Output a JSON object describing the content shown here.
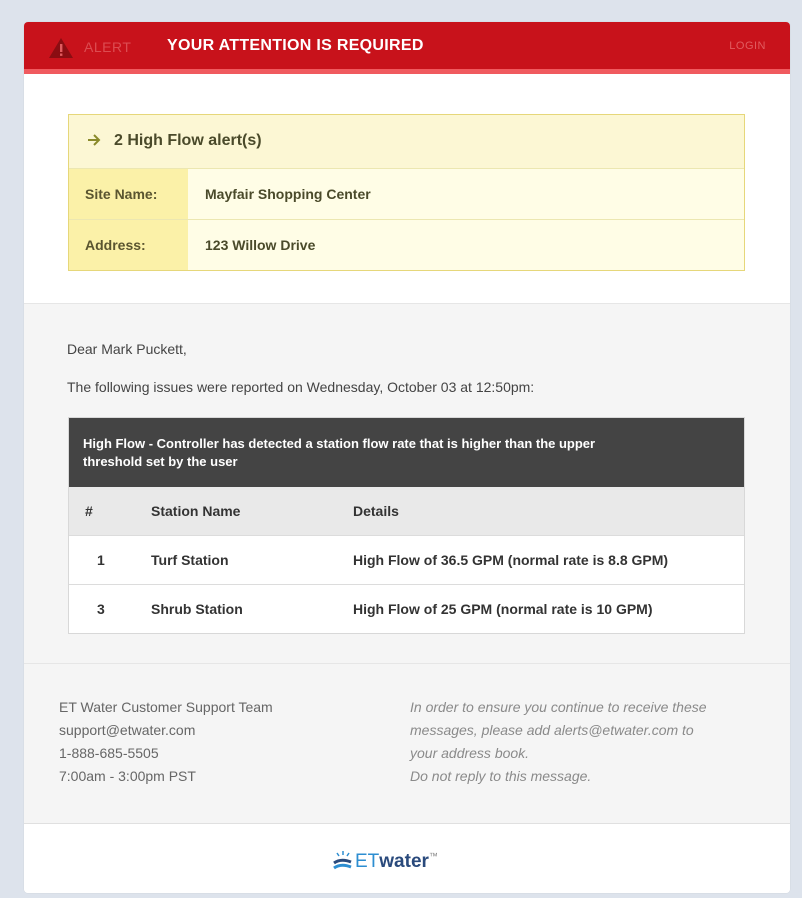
{
  "header": {
    "alert_label": "ALERT",
    "attention_text": "YOUR ATTENTION IS REQUIRED",
    "login_label": "LOGIN"
  },
  "summary": {
    "title": "2 High Flow alert(s)",
    "rows": [
      {
        "label": "Site Name:",
        "value": "Mayfair Shopping Center"
      },
      {
        "label": "Address:",
        "value": "123 Willow Drive"
      }
    ]
  },
  "message": {
    "greeting": "Dear Mark Puckett,",
    "intro": "The following issues were reported on Wednesday, October 03 at 12:50pm:"
  },
  "issues": {
    "heading_line1": "High Flow - Controller has detected a station flow rate that is higher than the upper",
    "heading_line2": "threshold set by the user",
    "columns": [
      "#",
      "Station Name",
      "Details"
    ],
    "rows": [
      {
        "num": "1",
        "station": "Turf Station",
        "details": "High Flow of 36.5 GPM (normal rate is 8.8 GPM)"
      },
      {
        "num": "3",
        "station": "Shrub Station",
        "details": "High Flow of 25 GPM (normal rate is 10 GPM)"
      }
    ]
  },
  "footer": {
    "team": "ET Water Customer Support Team",
    "email": "support@etwater.com",
    "phone": "1-888-685-5505",
    "hours": "7:00am - 3:00pm PST",
    "notice_lines": [
      "In order to ensure you continue to receive these",
      "messages, please add alerts@etwater.com to",
      "your address book.",
      "Do not reply to this message."
    ]
  },
  "logo": {
    "et": "ET",
    "water": "water",
    "tm": "™"
  },
  "colors": {
    "header_red": "#c8121b",
    "header_stripe": "#f05a5f",
    "summary_yellow": "#fffde6",
    "label_yellow": "#fbf1a8",
    "table_head": "#444444",
    "logo_blue": "#2d8ed1",
    "logo_navy": "#2a4a7c"
  },
  "icons": [
    "warning-icon",
    "arrow-right-icon",
    "etwater-logo-icon"
  ]
}
